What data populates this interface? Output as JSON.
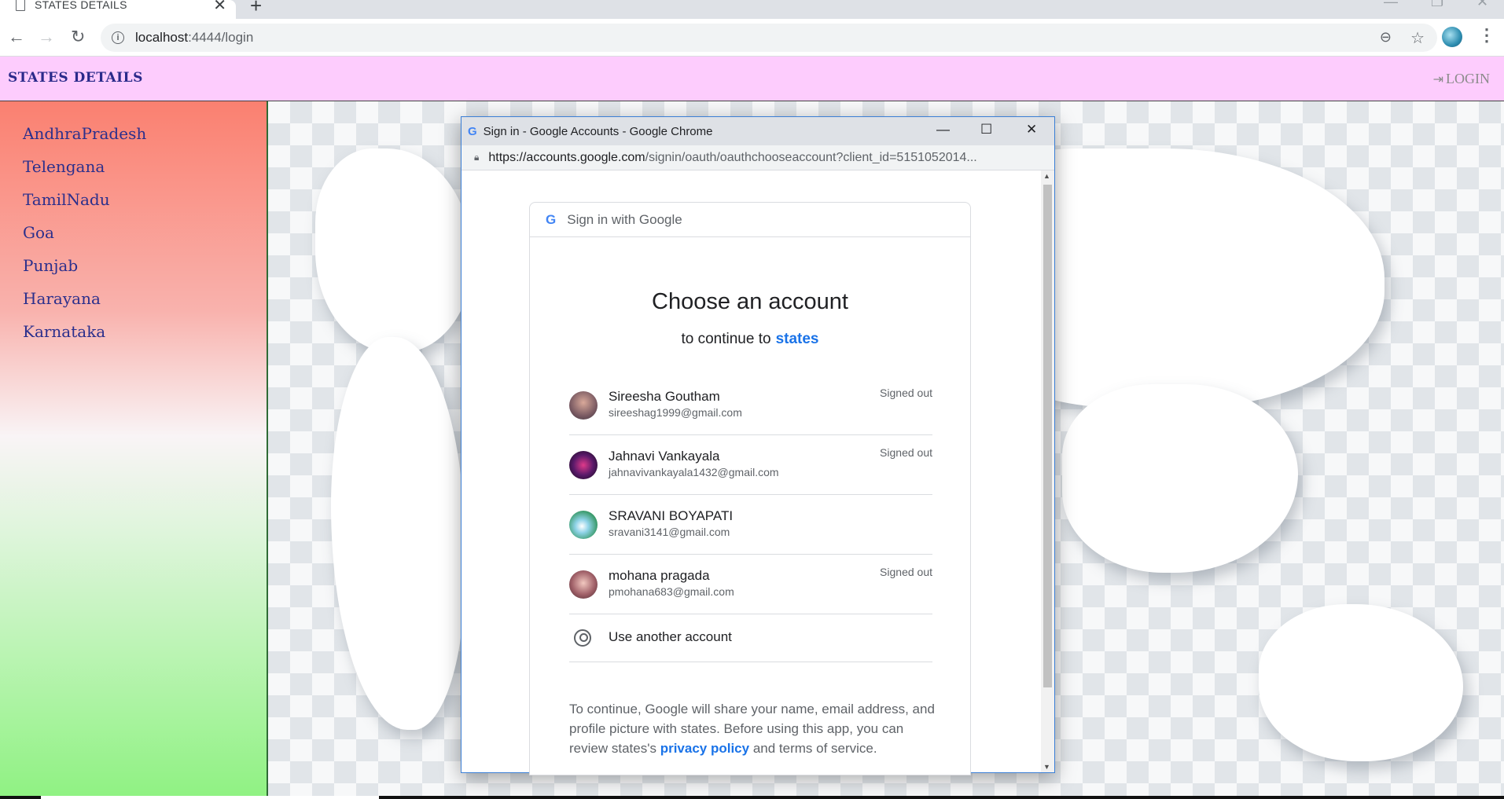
{
  "browser": {
    "tab_title": "STATES DETAILS",
    "tab_close": "✕",
    "new_tab": "+",
    "url_host": "localhost",
    "url_path": ":4444/login",
    "back": "←",
    "forward": "→",
    "reload": "↻"
  },
  "app": {
    "title": "STATES DETAILS",
    "login_label": "LOGIN",
    "colors": {
      "header_bg": "#fdccfd",
      "title": "#2a2a8a",
      "sidebar_text": "#2b2f8c"
    }
  },
  "sidebar": {
    "items": [
      "AndhraPradesh",
      "Telengana",
      "TamilNadu",
      "Goa",
      "Punjab",
      "Harayana",
      "Karnataka"
    ]
  },
  "popup": {
    "window_title": "Sign in - Google Accounts - Google Chrome",
    "url_domain": "https://accounts.google.com",
    "url_path": "/signin/oauth/oauthchooseaccount?client_id=5151052014...",
    "header_text": "Sign in with Google",
    "choose_title": "Choose an account",
    "continue_prefix": "to continue to",
    "app_name": "states",
    "accounts": [
      {
        "name": "Sireesha Goutham",
        "email": "sireeshag1999@gmail.com",
        "status": "Signed out"
      },
      {
        "name": "Jahnavi Vankayala",
        "email": "jahnavivankayala1432@gmail.com",
        "status": "Signed out"
      },
      {
        "name": "SRAVANI BOYAPATI",
        "email": "sravani3141@gmail.com",
        "status": ""
      },
      {
        "name": "mohana pragada",
        "email": "pmohana683@gmail.com",
        "status": "Signed out"
      }
    ],
    "use_another": "Use another account",
    "notice_1": "To continue, Google will share your name, email address, and profile picture with states. Before using this app, you can review states's",
    "privacy_link": "privacy policy",
    "notice_2": "and terms of service.",
    "link_color": "#1a73e8"
  }
}
